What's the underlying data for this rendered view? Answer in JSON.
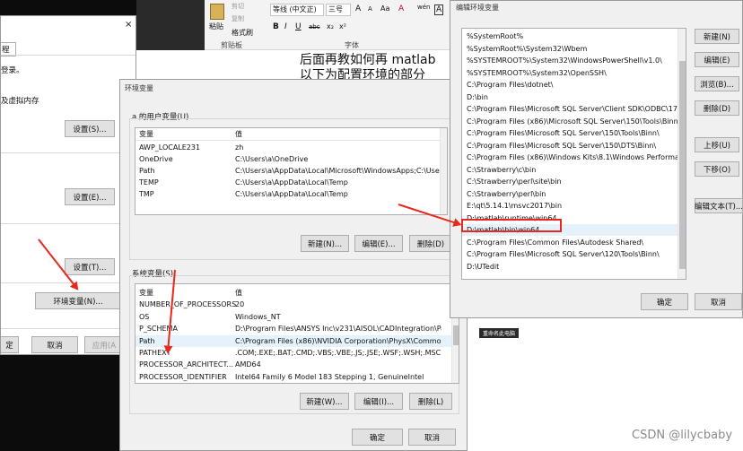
{
  "system_props": {
    "tab_partial": "程",
    "login_partial": "登录。",
    "perf_partial": "及虚拟内存",
    "settings1": "设置(S)...",
    "settings2": "设置(E)...",
    "settings3": "设置(T)...",
    "env_button": "环境变量(N)...",
    "ok_partial": "定",
    "cancel": "取消",
    "apply_partial": "应用(A"
  },
  "ribbon": {
    "paste": "粘贴",
    "format_painter": "格式刷",
    "clipboard": "剪贴板",
    "font_name": "等线 (中文正)",
    "font_size": "三号",
    "font_group": "字体",
    "cut_partial": "剪切",
    "copy_partial": "复制",
    "bold": "B",
    "italic": "I",
    "underline": "U",
    "strike": "abc",
    "subscript": "x₂",
    "superscript": "x²",
    "grow": "A",
    "shrink": "A",
    "case": "Aa",
    "clear": "A",
    "wen": "wén",
    "char_border": "A"
  },
  "document": {
    "line1": "后面再教如何再 matlab",
    "line2": "以下为配置环境的部分"
  },
  "env_dialog": {
    "title": "环境变量",
    "user_group": "a 的用户变量(U)",
    "col_var": "变量",
    "col_val": "值",
    "user_vars": [
      {
        "name": "AWP_LOCALE231",
        "value": "zh"
      },
      {
        "name": "OneDrive",
        "value": "C:\\Users\\a\\OneDrive"
      },
      {
        "name": "Path",
        "value": "C:\\Users\\a\\AppData\\Local\\Microsoft\\WindowsApps;C:\\Users..."
      },
      {
        "name": "TEMP",
        "value": "C:\\Users\\a\\AppData\\Local\\Temp"
      },
      {
        "name": "TMP",
        "value": "C:\\Users\\a\\AppData\\Local\\Temp"
      }
    ],
    "user_new": "新建(N)...",
    "user_edit": "编辑(E)...",
    "user_delete": "删除(D)",
    "sys_group": "系统变量(S)",
    "sys_vars": [
      {
        "name": "变量",
        "value": "值"
      },
      {
        "name": "NUMBER_OF_PROCESSORS",
        "value": "20"
      },
      {
        "name": "OS",
        "value": "Windows_NT"
      },
      {
        "name": "P_SCHEMA",
        "value": "D:\\Program Files\\ANSYS Inc\\v231\\AISOL\\CADIntegration\\Par..."
      },
      {
        "name": "Path",
        "value": "C:\\Program Files (x86)\\NVIDIA Corporation\\PhysX\\Common;..."
      },
      {
        "name": "PATHEXT",
        "value": ".COM;.EXE;.BAT;.CMD;.VBS;.VBE;.JS;.JSE;.WSF;.WSH;.MSC"
      },
      {
        "name": "PROCESSOR_ARCHITECT...",
        "value": "AMD64"
      },
      {
        "name": "PROCESSOR_IDENTIFIER",
        "value": "Intel64 Family 6 Model 183 Stepping 1, GenuineIntel"
      }
    ],
    "sys_new": "新建(W)...",
    "sys_edit": "编辑(I)...",
    "sys_delete": "删除(L)",
    "ok": "确定",
    "cancel": "取消"
  },
  "edit_dialog": {
    "title": "编辑环境变量",
    "entries": [
      "%SystemRoot%",
      "%SystemRoot%\\System32\\Wbem",
      "%SYSTEMROOT%\\System32\\WindowsPowerShell\\v1.0\\",
      "%SYSTEMROOT%\\System32\\OpenSSH\\",
      "C:\\Program Files\\dotnet\\",
      "D:\\bin",
      "C:\\Program Files\\Microsoft SQL Server\\Client SDK\\ODBC\\17...",
      "C:\\Program Files (x86)\\Microsoft SQL Server\\150\\Tools\\Binn\\",
      "C:\\Program Files\\Microsoft SQL Server\\150\\Tools\\Binn\\",
      "C:\\Program Files\\Microsoft SQL Server\\150\\DTS\\Binn\\",
      "C:\\Program Files (x86)\\Windows Kits\\8.1\\Windows Performa...",
      "C:\\Strawberry\\c\\bin",
      "C:\\Strawberry\\perl\\site\\bin",
      "C:\\Strawberry\\perl\\bin",
      "E:\\qt\\5.14.1\\msvc2017\\bin",
      "D:\\matlab\\runtime\\win64",
      "D:\\matlab\\bin\\win64",
      "C:\\Program Files\\Common Files\\Autodesk Shared\\",
      "C:\\Program Files\\Microsoft SQL Server\\120\\Tools\\Binn\\",
      "D:\\UTedit"
    ],
    "btn_new": "新建(N)",
    "btn_edit": "编辑(E)",
    "btn_browse": "浏览(B)...",
    "btn_delete": "删除(D)",
    "btn_up": "上移(U)",
    "btn_down": "下移(O)",
    "btn_edit_text": "编辑文本(T)...",
    "ok": "确定",
    "cancel": "取消"
  },
  "taskbar_label": "重命名此电脑",
  "watermark": "CSDN @lilycbaby",
  "colors": {
    "highlight": "#e8281c",
    "selected_row": "#e5f1fb",
    "dialog_bg": "#f0f0f0"
  }
}
